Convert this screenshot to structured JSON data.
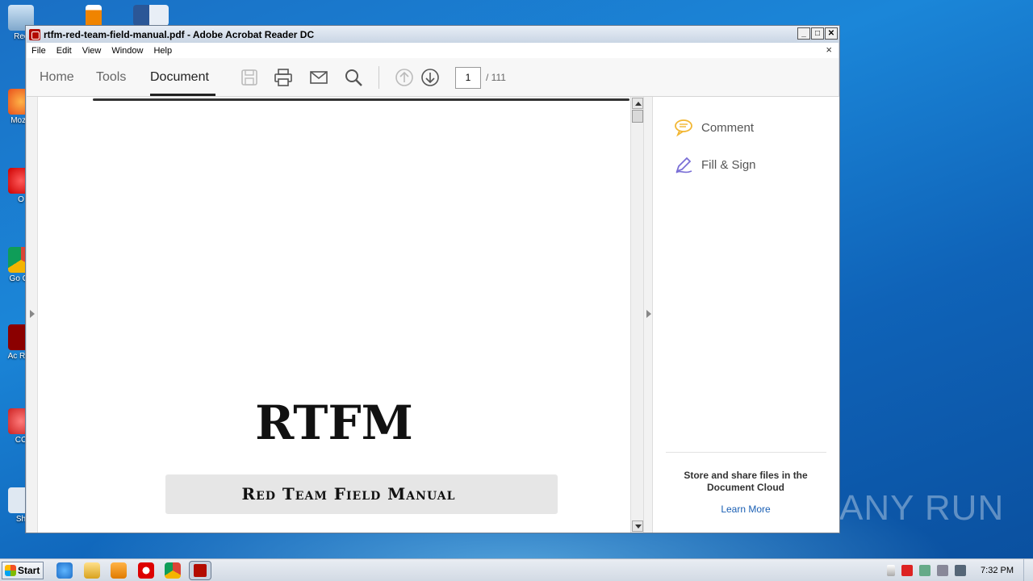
{
  "desktop": {
    "icons": [
      "Rec",
      "Mozill",
      "O",
      "Go Ch",
      "Ac Rea",
      "CC",
      "Sh"
    ],
    "watermark": "ANY RUN"
  },
  "window": {
    "title": "rtfm-red-team-field-manual.pdf - Adobe Acrobat Reader DC",
    "controls": {
      "minimize": "_",
      "maximize": "□",
      "close": "✕"
    }
  },
  "menu": {
    "items": [
      "File",
      "Edit",
      "View",
      "Window",
      "Help"
    ],
    "close_doc": "×"
  },
  "toolbar": {
    "tabs": [
      "Home",
      "Tools",
      "Document"
    ],
    "active_tab": "Document",
    "page_current": "1",
    "page_total": "/  111",
    "icons": [
      "save-icon",
      "print-icon",
      "email-icon",
      "search-icon",
      "page-up-icon",
      "page-down-icon"
    ]
  },
  "document": {
    "title": "RTFM",
    "subtitle": "Red Team Field Manual"
  },
  "right_panel": {
    "items": [
      {
        "label": "Comment",
        "icon": "comment-icon",
        "color": "#f2b632"
      },
      {
        "label": "Fill & Sign",
        "icon": "fill-sign-icon",
        "color": "#7a6fd6"
      }
    ],
    "cloud_text": "Store and share files in the Document Cloud",
    "learn_more": "Learn More"
  },
  "taskbar": {
    "start_label": "Start",
    "apps": [
      "internet-explorer-icon",
      "explorer-icon",
      "media-player-icon",
      "opera-icon",
      "chrome-icon",
      "acrobat-icon"
    ],
    "clock": "7:32 PM"
  }
}
